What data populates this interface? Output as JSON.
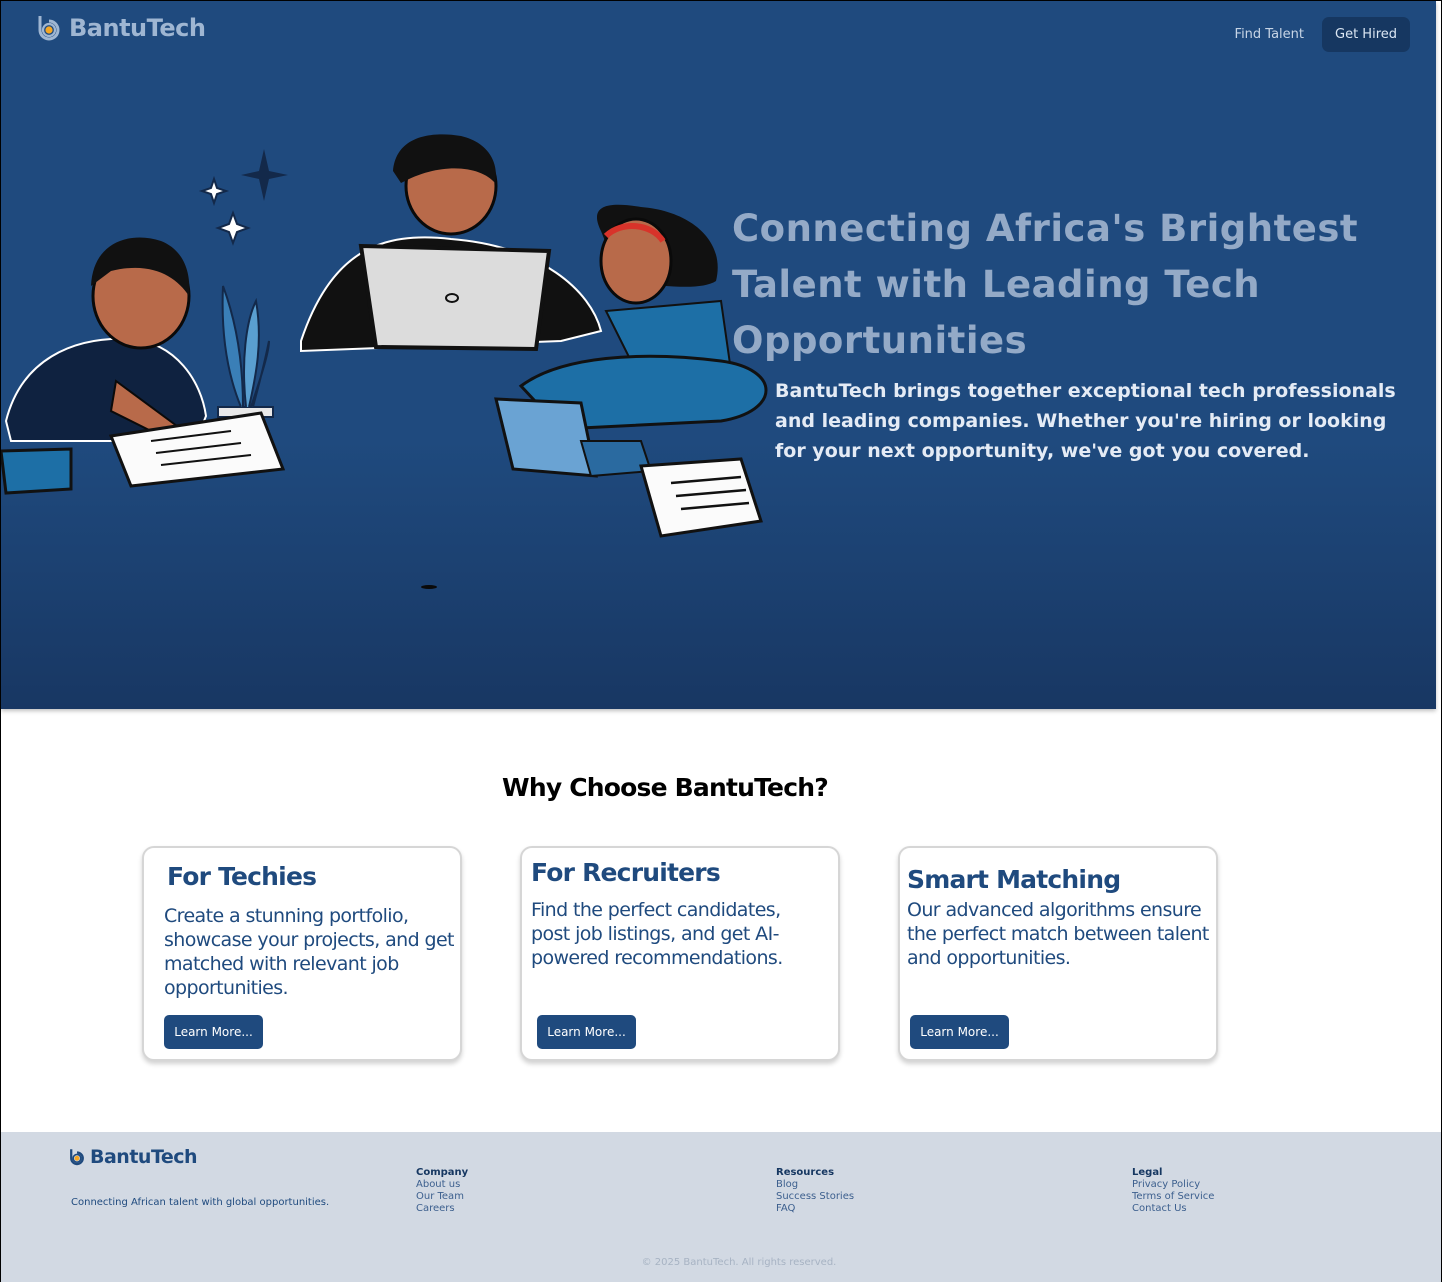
{
  "brand": {
    "name": "BantuTech"
  },
  "nav": {
    "find_talent": "Find Talent",
    "get_hired": "Get Hired"
  },
  "hero": {
    "title": "Connecting Africa's Brightest Talent with Leading Tech Opportunities",
    "subtitle": "BantuTech brings together exceptional tech professionals and leading companies. Whether you're hiring or looking for your next opportunity, we've got you covered."
  },
  "features": {
    "heading": "Why Choose BantuTech?",
    "cards": [
      {
        "title": "For Techies",
        "text": "Create a stunning portfolio, showcase your projects, and get matched with relevant job opportunities.",
        "button": "Learn More..."
      },
      {
        "title": "For Recruiters",
        "text": "Find the perfect candidates, post job listings, and get AI-powered recommendations.",
        "button": "Learn More..."
      },
      {
        "title": "Smart Matching",
        "text": "Our advanced algorithms ensure the perfect match between talent and opportunities.",
        "button": "Learn More..."
      }
    ]
  },
  "footer": {
    "tagline": "Connecting African talent with global opportunities.",
    "columns": [
      {
        "heading": "Company",
        "links": [
          "About us",
          "Our Team",
          "Careers"
        ]
      },
      {
        "heading": "Resources",
        "links": [
          "Blog",
          "Success Stories",
          "FAQ"
        ]
      },
      {
        "heading": "Legal",
        "links": [
          "Privacy Policy",
          "Terms of Service",
          "Contact Us"
        ]
      }
    ],
    "copyright": "© 2025 BantuTech. All rights reserved."
  },
  "colors": {
    "primary": "#1f4a7e",
    "dark": "#163761",
    "accent": "#f5a623",
    "footer_bg": "#d2d9e3"
  },
  "icons": {
    "logo": "bantutech-logo-icon"
  }
}
